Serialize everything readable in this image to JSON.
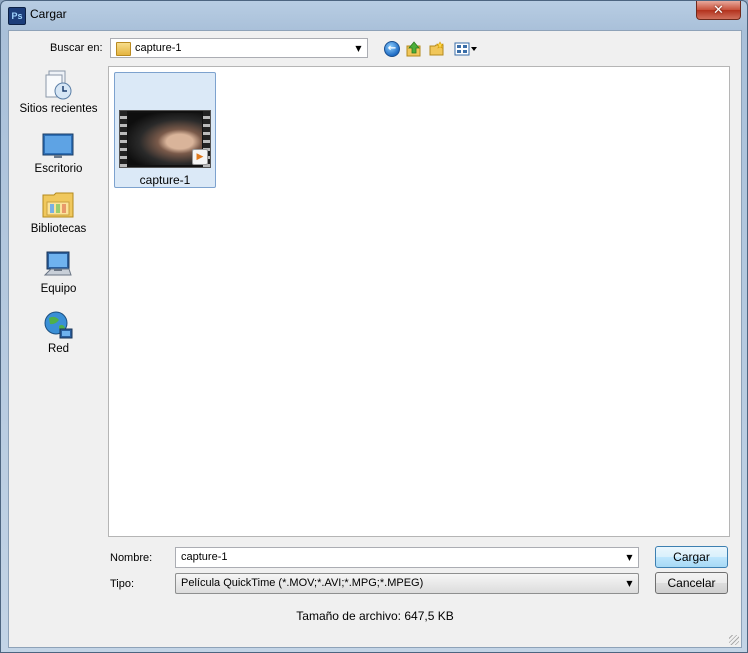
{
  "window": {
    "title": "Cargar",
    "app_icon_text": "Ps",
    "close_glyph": "✕"
  },
  "toolbar": {
    "lookin_label": "Buscar en:",
    "lookin_value": "capture-1",
    "icons": [
      "back-icon",
      "up-folder-icon",
      "new-folder-icon",
      "view-menu-icon"
    ]
  },
  "places": [
    {
      "label": "Sitios recientes",
      "icon": "recent-places-icon"
    },
    {
      "label": "Escritorio",
      "icon": "desktop-icon"
    },
    {
      "label": "Bibliotecas",
      "icon": "libraries-icon"
    },
    {
      "label": "Equipo",
      "icon": "computer-icon"
    },
    {
      "label": "Red",
      "icon": "network-icon"
    }
  ],
  "files": [
    {
      "name": "capture-1",
      "icon": "video-thumbnail"
    }
  ],
  "form": {
    "name_label": "Nombre:",
    "name_value": "capture-1",
    "type_label": "Tipo:",
    "type_value": "Película QuickTime (*.MOV;*.AVI;*.MPG;*.MPEG)",
    "open_button": "Cargar",
    "cancel_button": "Cancelar",
    "file_size": "Tamaño de archivo: 647,5 KB"
  },
  "colors": {
    "frame": "#a9c0d9",
    "selection": "#dbe9f7",
    "default_button_border": "#3c7fb1"
  }
}
